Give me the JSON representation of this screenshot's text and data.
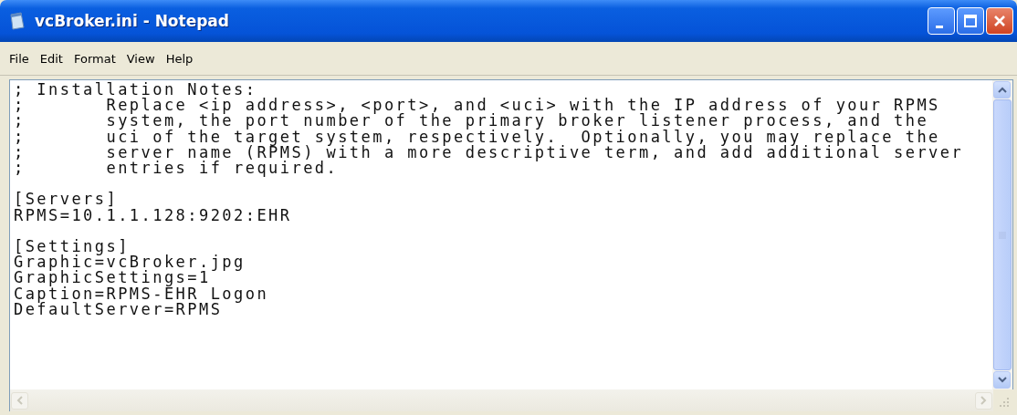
{
  "window": {
    "title": "vcBroker.ini - Notepad"
  },
  "menu": [
    "File",
    "Edit",
    "Format",
    "View",
    "Help"
  ],
  "document": {
    "blocks": [
      [
        "; Installation Notes:",
        ";\tReplace <ip address>, <port>, and <uci> with the IP address of your RPMS",
        ";\tsystem, the port number of the primary broker listener process, and the",
        ";\tuci of the target system, respectively.  Optionally, you may replace the",
        ";\tserver name (RPMS) with a more descriptive term, and add additional server",
        ";\tentries if required."
      ],
      [
        "[Servers]",
        "RPMS=10.1.1.128:9202:EHR"
      ],
      [
        "[Settings]",
        "Graphic=vcBroker.jpg",
        "GraphicSettings=1",
        "Caption=RPMS-EHR Logon",
        "DefaultServer=RPMS"
      ]
    ]
  }
}
